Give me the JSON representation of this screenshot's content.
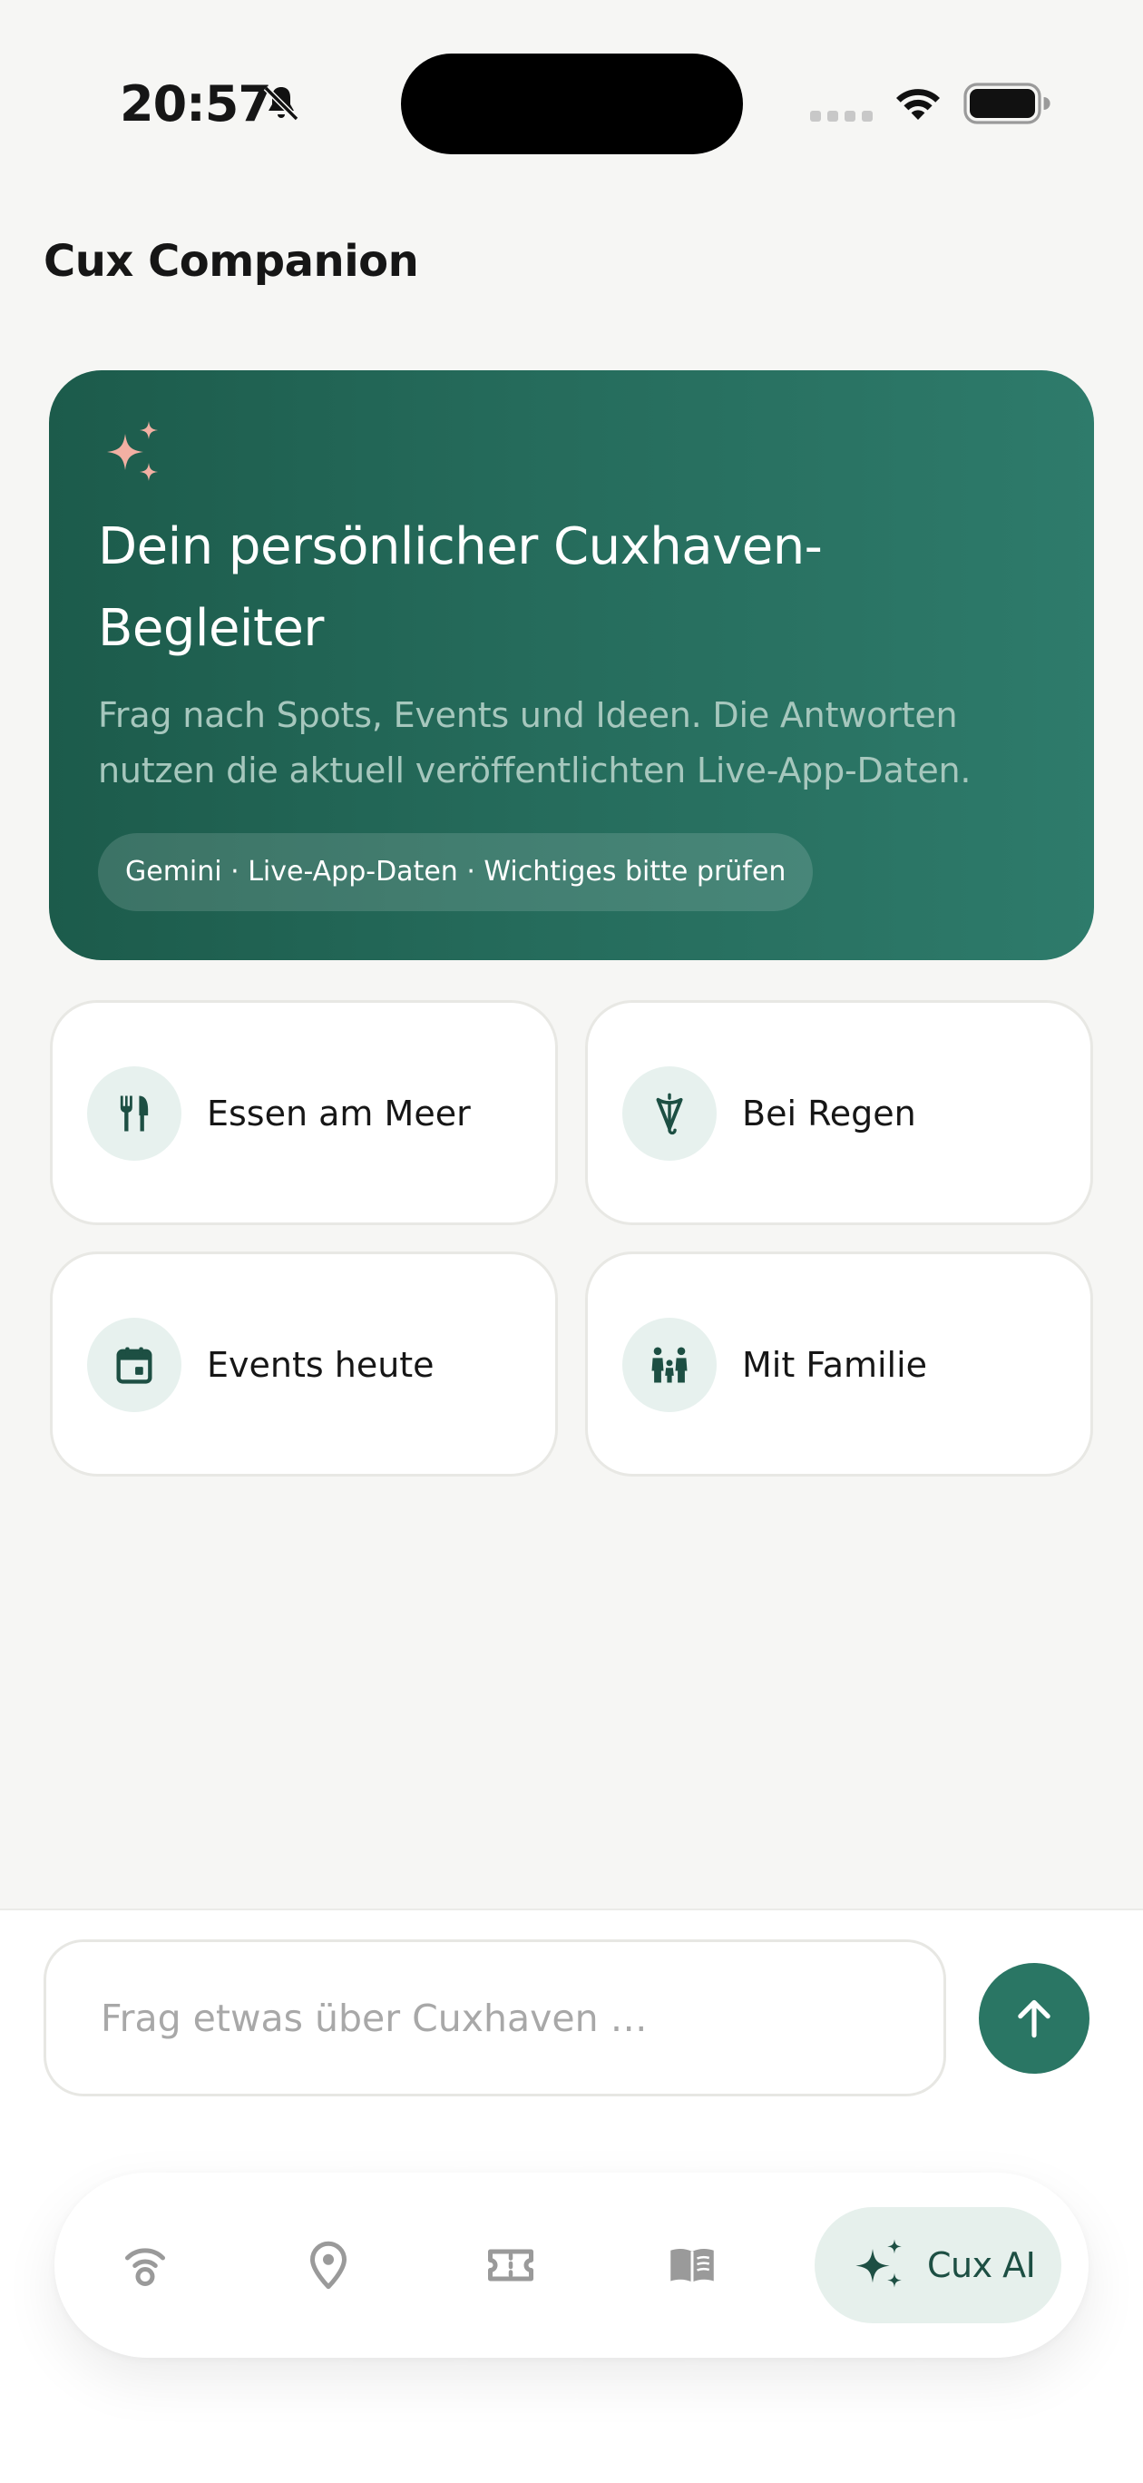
{
  "status_bar": {
    "time": "20:57",
    "icons": [
      "bell-slash-icon",
      "signal-dots-icon",
      "wifi-icon",
      "battery-icon"
    ]
  },
  "header": {
    "title": "Cux Companion"
  },
  "hero": {
    "icon": "sparkles-icon",
    "heading": "Dein persönlicher Cuxhaven-Begleiter",
    "description": "Frag nach Spots, Events und Ideen. Die Antworten nutzen die aktuell veröffentlichten Live-App-Daten.",
    "pill": "Gemini · Live-App-Daten · Wichtiges bitte prüfen"
  },
  "suggestions": [
    {
      "label": "Essen am Meer",
      "icon": "fork-knife-icon"
    },
    {
      "label": "Bei Regen",
      "icon": "umbrella-icon"
    },
    {
      "label": "Events heute",
      "icon": "calendar-icon"
    },
    {
      "label": "Mit Familie",
      "icon": "family-icon"
    }
  ],
  "composer": {
    "placeholder": "Frag etwas über Cuxhaven …",
    "value": "",
    "send_icon": "arrow-up-icon"
  },
  "bottom_nav": {
    "items": [
      {
        "icon": "live-signal-icon",
        "active": false
      },
      {
        "icon": "map-pin-icon",
        "active": false
      },
      {
        "icon": "ticket-icon",
        "active": false
      },
      {
        "icon": "book-icon",
        "active": false
      },
      {
        "icon": "sparkles-icon",
        "label": "Cux AI",
        "active": true
      }
    ]
  },
  "colors": {
    "accent": "#2a7664",
    "hero_gradient": [
      "#1c5b4b",
      "#2e7b6b"
    ],
    "sparkle": "#f2b0a3",
    "background": "#f6f6f4",
    "icon_inactive": "#9a9a9a"
  }
}
